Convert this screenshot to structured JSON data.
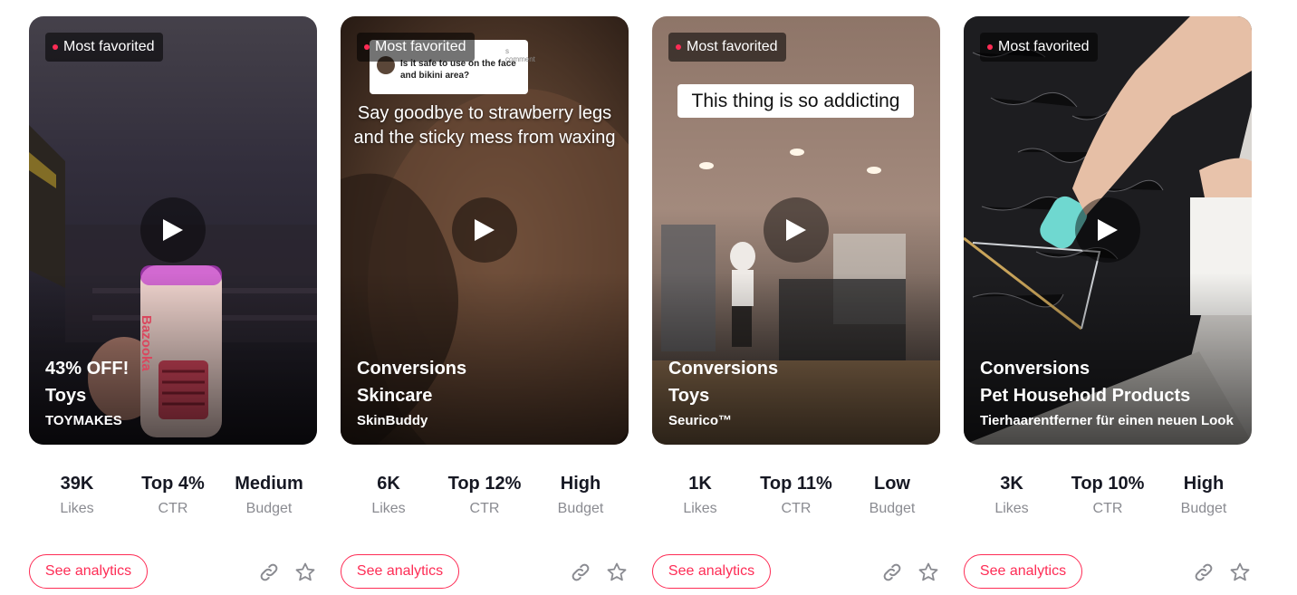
{
  "cards": [
    {
      "badge": "Most favorited",
      "line1": "43% OFF!",
      "line2": "Toys",
      "brand": "TOYMAKES",
      "stats": [
        {
          "value": "39K",
          "label": "Likes"
        },
        {
          "value": "Top 4%",
          "label": "CTR"
        },
        {
          "value": "Medium",
          "label": "Budget"
        }
      ],
      "analytics_label": "See analytics",
      "product_text": "Bazooka"
    },
    {
      "badge": "Most favorited",
      "line1": "Conversions",
      "line2": "Skincare",
      "brand": "SkinBuddy",
      "stats": [
        {
          "value": "6K",
          "label": "Likes"
        },
        {
          "value": "Top 12%",
          "label": "CTR"
        },
        {
          "value": "High",
          "label": "Budget"
        }
      ],
      "analytics_label": "See analytics",
      "comment_reply": "s comment",
      "comment_text": "Is it safe to use on the face and bikini area?",
      "overlay_text": "Say goodbye to strawberry legs and the sticky mess from waxing"
    },
    {
      "badge": "Most favorited",
      "line1": "Conversions",
      "line2": "Toys",
      "brand": "Seurico™",
      "stats": [
        {
          "value": "1K",
          "label": "Likes"
        },
        {
          "value": "Top 11%",
          "label": "CTR"
        },
        {
          "value": "Low",
          "label": "Budget"
        }
      ],
      "analytics_label": "See analytics",
      "overlay_text": "This thing is so addicting"
    },
    {
      "badge": "Most favorited",
      "line1": "Conversions",
      "line2": "Pet Household Products",
      "brand": "Tierhaarentferner für einen neuen Look",
      "stats": [
        {
          "value": "3K",
          "label": "Likes"
        },
        {
          "value": "Top 10%",
          "label": "CTR"
        },
        {
          "value": "High",
          "label": "Budget"
        }
      ],
      "analytics_label": "See analytics"
    }
  ],
  "colors": {
    "accent": "#fe2c55",
    "stat_value": "#161823",
    "stat_label": "#8a8b91"
  },
  "icons": {
    "play": "play-icon",
    "link": "link-icon",
    "star": "star-icon",
    "badge_dot": "dot-icon"
  }
}
